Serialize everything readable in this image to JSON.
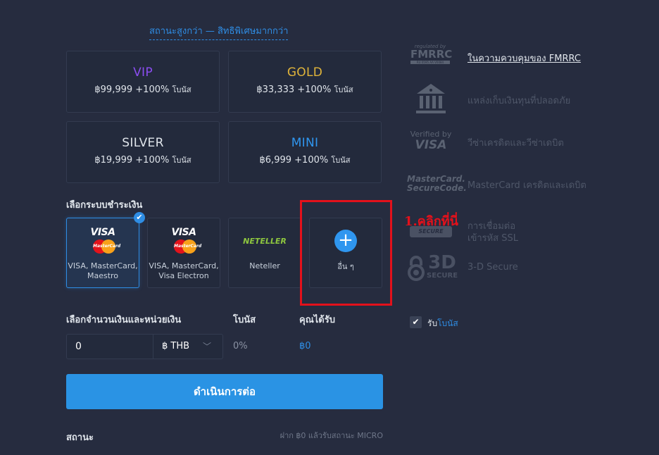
{
  "header": {
    "status_link": "สถานะสูงกว่า — สิทธิพิเศษมากกว่า"
  },
  "tiers": [
    {
      "name": "VIP",
      "amount": "฿99,999",
      "bonus": "+100%",
      "bonus_label": "โบนัส",
      "color": "#8a4df0"
    },
    {
      "name": "GOLD",
      "amount": "฿33,333",
      "bonus": "+100%",
      "bonus_label": "โบนัส",
      "color": "#e0b43a"
    },
    {
      "name": "SILVER",
      "amount": "฿19,999",
      "bonus": "+100%",
      "bonus_label": "โบนัส",
      "color": "#dfe4ea"
    },
    {
      "name": "MINI",
      "amount": "฿6,999",
      "bonus": "+100%",
      "bonus_label": "โบนัส",
      "color": "#2f96ef"
    }
  ],
  "payment": {
    "label": "เลือกระบบชำระเงิน",
    "methods": [
      {
        "logo": "VISA",
        "logo2": "MasterCard",
        "line1": "VISA, MasterCard,",
        "line2": "Maestro",
        "selected": true
      },
      {
        "logo": "VISA",
        "logo2": "MasterCard",
        "line1": "VISA, MasterCard,",
        "line2": "Visa Electron",
        "selected": false
      },
      {
        "logo": "NETELLER",
        "line1": "Neteller",
        "selected": false
      },
      {
        "icon": "plus-icon",
        "line1": "อื่น ๆ",
        "selected": false
      }
    ],
    "annotation": "1.คลิกที่นี่"
  },
  "amount": {
    "label": "เลือกจำนวนเงินและหน่วยเงิน",
    "value": "0",
    "currency": "฿ THB",
    "bonus_label": "โบนัส",
    "bonus_value": "0%",
    "receive_label": "คุณได้รับ",
    "receive_value": "฿0"
  },
  "cta": {
    "label": "ดำเนินการต่อ"
  },
  "status": {
    "label": "สถานะ",
    "hint": "ฝาก ฿0 แล้วรับสถานะ MICRO"
  },
  "trust": {
    "fmrrc_small": "regulated by",
    "fmrrc_big": "FMRRC",
    "fmrrc_code": "RU 0595 AA V0084",
    "fmrrc_text": "ในความควบคุมของ FMRRC",
    "bank_text": "แหล่งเก็บเงินทุนที่ปลอดภัย",
    "vbv_small": "Verified by",
    "vbv_big": "VISA",
    "vbv_text": "วีซ่าเครดิตและวีซ่าเดบิต",
    "mc_line1": "MasterCard.",
    "mc_line2": "SecureCode.",
    "mc_text": "MasterCard เครดิตและเดบิต",
    "ssl_badge": "SECURE",
    "ssl_line1": "การเชื่อมต่อ",
    "ssl_line2": "เข้ารหัส SSL",
    "three_d_big": "3D",
    "three_d_small": "SECURE",
    "three_d_text": "3-D Secure"
  },
  "bonus_checkbox": {
    "prefix": "รับ",
    "link": "โบนัส",
    "checked": true
  }
}
